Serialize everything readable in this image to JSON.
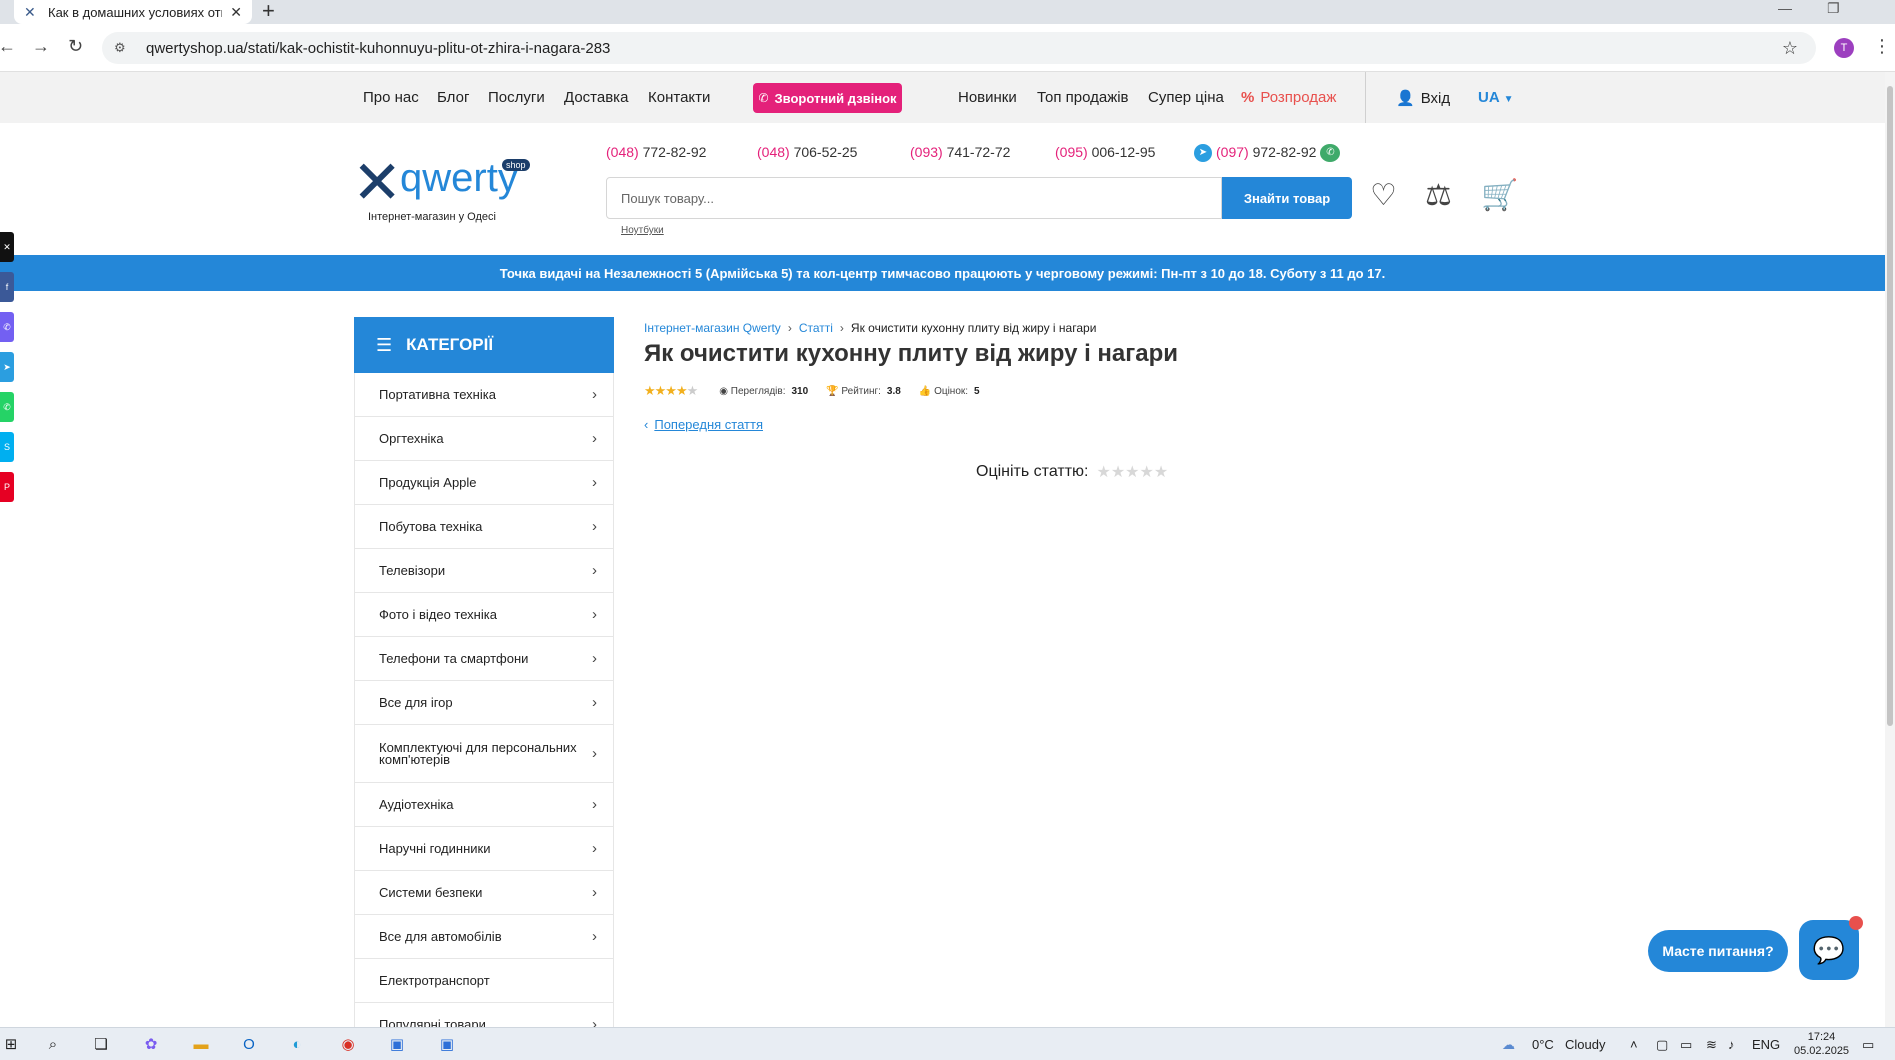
{
  "browser": {
    "tab_title": "Как в домашних условиях отм",
    "tab_close": "✕",
    "new_tab": "+",
    "url": "qwertyshop.ua/stati/kak-ochistit-kuhonnuyu-plitu-ot-zhira-i-nagara-283",
    "avatar_letter": "T"
  },
  "topnav": {
    "links": [
      "Про нас",
      "Блог",
      "Послуги",
      "Доставка",
      "Контакти"
    ],
    "callback": "Зворотний дзвінок",
    "links_right": [
      "Новинки",
      "Топ продажів",
      "Супер ціна"
    ],
    "sale": "Розпродаж",
    "login": "Вхід",
    "lang": "UA"
  },
  "header": {
    "logo_word": "qwerty",
    "logo_badge": "shop",
    "logo_subtitle": "Інтернет-магазин у Одесі",
    "phones": [
      {
        "code": "(048)",
        "num": " 772-82-92"
      },
      {
        "code": "(048)",
        "num": " 706-52-25"
      },
      {
        "code": "(093)",
        "num": " 741-72-72"
      },
      {
        "code": "(095)",
        "num": " 006-12-95"
      },
      {
        "code": "(097)",
        "num": " 972-82-92"
      }
    ],
    "search_placeholder": "Пошук товару...",
    "search_button": "Знайти товар",
    "search_hint": "Ноутбуки"
  },
  "notice": "Точка видачі на Незалежності 5 (Армійська 5) та кол-центр тимчасово працюють у черговому режимі: Пн-пт з 10 до 18. Суботу з 11 до 17.",
  "sidebar": {
    "title": "КАТЕГОРІЇ",
    "items": [
      {
        "label": "Портативна техніка",
        "chevron": true
      },
      {
        "label": "Оргтехніка",
        "chevron": true
      },
      {
        "label": "Продукція Apple",
        "chevron": true
      },
      {
        "label": "Побутова техніка",
        "chevron": true
      },
      {
        "label": "Телевізори",
        "chevron": true
      },
      {
        "label": "Фото і відео техніка",
        "chevron": true
      },
      {
        "label": "Телефони та смартфони",
        "chevron": true
      },
      {
        "label": "Все для ігор",
        "chevron": true
      },
      {
        "label": "Комплектуючі для персональних комп'ютерів",
        "chevron": true
      },
      {
        "label": "Аудіотехніка",
        "chevron": true
      },
      {
        "label": "Наручні годинники",
        "chevron": true
      },
      {
        "label": "Системи безпеки",
        "chevron": true
      },
      {
        "label": "Все для автомобілів",
        "chevron": true
      },
      {
        "label": "Електротранспорт",
        "chevron": false
      },
      {
        "label": "Популярні товари",
        "chevron": true
      }
    ]
  },
  "article": {
    "breadcrumbs": [
      "Інтернет-магазин Qwerty",
      "Статті",
      "Як очистити кухонну плиту від жиру і нагари"
    ],
    "title": "Як очистити кухонну плиту від жиру і нагари",
    "rating_stars": 3.8,
    "views_label": "Переглядів:",
    "views": "310",
    "rating_label": "Рейтинг:",
    "rating": "3.8",
    "votes_label": "Оцінок:",
    "votes": "5",
    "prev_link": "Попередня стаття",
    "rate_prompt": "Оцініть статтю:"
  },
  "chat": {
    "bubble": "Масте питання?"
  },
  "taskbar": {
    "weather_temp": "0°C",
    "weather_text": "Cloudy",
    "lang": "ENG",
    "time": "17:24",
    "date": "05.02.2025"
  },
  "colors": {
    "accent": "#2487d8",
    "brand_pink": "#e4217a",
    "sale_red": "#e8504d",
    "star": "#f2b01e"
  }
}
